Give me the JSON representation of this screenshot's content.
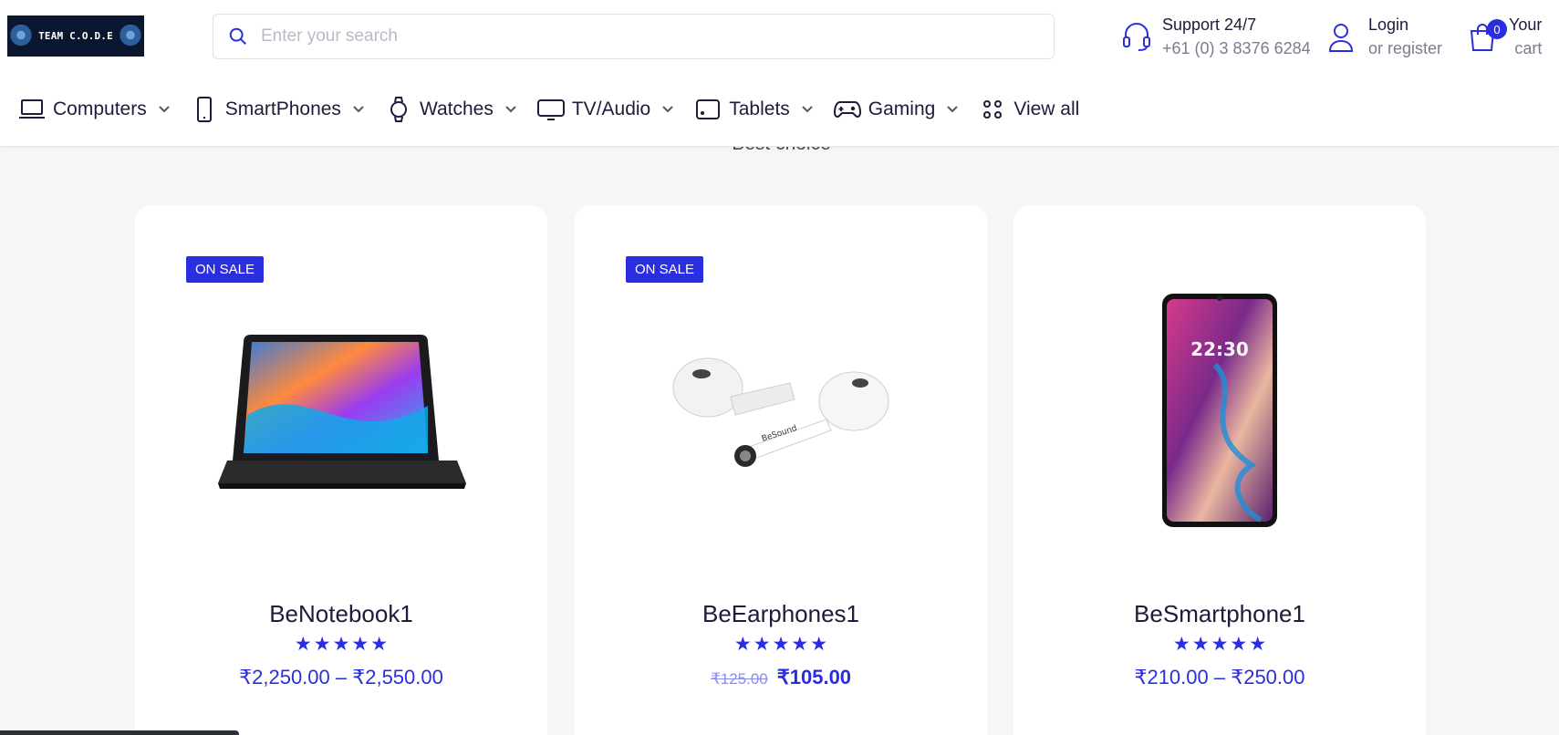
{
  "logo": {
    "text": "TEAM C.O.D.E"
  },
  "search": {
    "placeholder": "Enter your search"
  },
  "support": {
    "title": "Support 24/7",
    "phone": "+61 (0) 3 8376 6284"
  },
  "account": {
    "login": "Login",
    "register": "or register"
  },
  "cart": {
    "count": "0",
    "line1": "Your",
    "line2": "cart"
  },
  "nav": [
    {
      "label": "Computers",
      "icon": "laptop-icon"
    },
    {
      "label": "SmartPhones",
      "icon": "smartphone-icon"
    },
    {
      "label": "Watches",
      "icon": "watch-icon"
    },
    {
      "label": "TV/Audio",
      "icon": "tv-icon"
    },
    {
      "label": "Tablets",
      "icon": "tablet-icon"
    },
    {
      "label": "Gaming",
      "icon": "gamepad-icon"
    },
    {
      "label": "View all",
      "icon": "grid-icon"
    }
  ],
  "section": {
    "subtitle": "Best choice"
  },
  "products": [
    {
      "sale_badge": "ON SALE",
      "name": "BeNotebook1",
      "rating": 5,
      "price": "₹2,250.00 – ₹2,550.00",
      "image": "laptop-tablet-image"
    },
    {
      "sale_badge": "ON SALE",
      "name": "BeEarphones1",
      "rating": 5,
      "old_price": "₹125.00",
      "price": "₹105.00",
      "image": "earbuds-image"
    },
    {
      "name": "BeSmartphone1",
      "rating": 5,
      "price": "₹210.00 – ₹250.00",
      "image": "phone-image",
      "screen_time": "22:30"
    }
  ],
  "colors": {
    "accent": "#2a2ee0",
    "text": "#1b1d3a",
    "muted": "#7b7c8e",
    "page_bg": "#f6f6f6"
  }
}
